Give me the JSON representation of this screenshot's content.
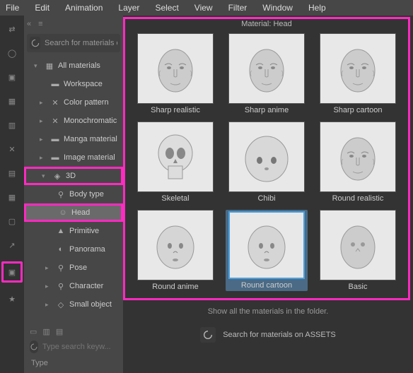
{
  "menu": [
    "File",
    "Edit",
    "Animation",
    "Layer",
    "Select",
    "View",
    "Filter",
    "Window",
    "Help"
  ],
  "search_placeholder": "Search for materials on A",
  "tree": {
    "root": "All materials",
    "items": [
      {
        "label": "Workspace",
        "indent": 2
      },
      {
        "label": "Color pattern",
        "indent": 2,
        "chev": true
      },
      {
        "label": "Monochromatic",
        "indent": 2,
        "chev": true
      },
      {
        "label": "Manga material",
        "indent": 2,
        "chev": true
      },
      {
        "label": "Image material",
        "indent": 2,
        "chev": true
      },
      {
        "label": "3D",
        "indent": 2,
        "chev": true,
        "hl": true,
        "open": true
      },
      {
        "label": "Body type",
        "indent": 3
      },
      {
        "label": "Head",
        "indent": 3,
        "hl": true,
        "sel": true
      },
      {
        "label": "Primitive",
        "indent": 3
      },
      {
        "label": "Panorama",
        "indent": 3
      },
      {
        "label": "Pose",
        "indent": 3,
        "chev": true
      },
      {
        "label": "Character",
        "indent": 3,
        "chev": true
      },
      {
        "label": "Small object",
        "indent": 3,
        "chev": true
      }
    ]
  },
  "kw_placeholder": "Type search keyw...",
  "type_label": "Type",
  "material_title": "Material: Head",
  "thumbs": [
    {
      "label": "Sharp realistic",
      "style": "realistic"
    },
    {
      "label": "Sharp anime",
      "style": "anime"
    },
    {
      "label": "Sharp cartoon",
      "style": "cartoon"
    },
    {
      "label": "Skeletal",
      "style": "skull"
    },
    {
      "label": "Chibi",
      "style": "chibi"
    },
    {
      "label": "Round realistic",
      "style": "realistic"
    },
    {
      "label": "Round anime",
      "style": "round"
    },
    {
      "label": "Round cartoon",
      "style": "round",
      "selected": true
    },
    {
      "label": "Basic",
      "style": "basic"
    }
  ],
  "showall": "Show all the materials in the folder.",
  "assets_label": "Search for materials on ASSETS"
}
